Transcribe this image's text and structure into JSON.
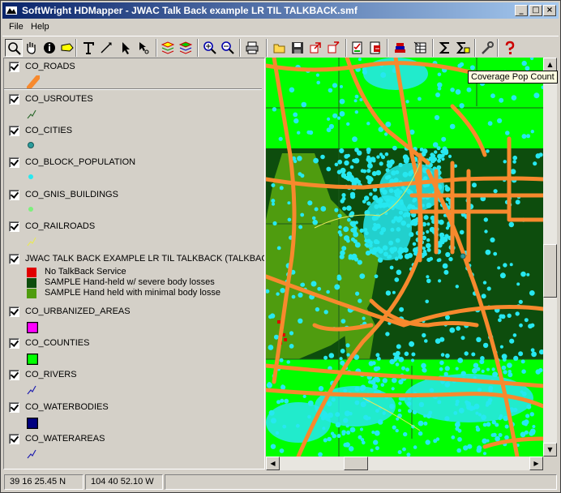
{
  "window": {
    "title": "SoftWright HDMapper - JWAC Talk Back example LR TIL TALKBACK.smf"
  },
  "window_controls": {
    "minimize": "_",
    "maximize": "□",
    "close": "×"
  },
  "menu": {
    "items": [
      "File",
      "Help"
    ]
  },
  "toolbar": {
    "tools": [
      "zoom-select-icon",
      "pan-hand-icon",
      "info-icon",
      "label-icon",
      "text-icon",
      "measure-line-icon",
      "select-arrow-icon",
      "node-select-icon",
      "layers-add-icon",
      "layers-edit-icon",
      "zoom-in-icon",
      "zoom-out-icon",
      "print-icon",
      "open-folder-icon",
      "save-icon",
      "export-icon",
      "import-icon",
      "checklist-icon",
      "report-icon",
      "stack-icon",
      "table-icon",
      "sum-icon",
      "sum-highlight-icon",
      "wrench-icon",
      "help-icon"
    ]
  },
  "tooltip": {
    "text": "Coverage Pop Count"
  },
  "legend": {
    "layers": [
      {
        "name": "CO_ROADS",
        "symbol": "road-line",
        "color": "#f7892d"
      },
      {
        "name": "CO_USROUTES",
        "symbol": "line",
        "color": "#2f6b2f"
      },
      {
        "name": "CO_CITIES",
        "symbol": "dot",
        "color": "#2a9c9c"
      },
      {
        "name": "CO_BLOCK_POPULATION",
        "symbol": "small-dot",
        "color": "#27e8f0"
      },
      {
        "name": "CO_GNIS_BUILDINGS",
        "symbol": "small-dot",
        "color": "#7df07d"
      },
      {
        "name": "CO_RAILROADS",
        "symbol": "line",
        "color": "#e8e85a"
      },
      {
        "name": "JWAC TALK BACK EXAMPLE LR TIL TALKBACK (TALKBACK)",
        "symbol": "classes",
        "classes": [
          {
            "label": "No TalkBack Service",
            "color": "#e00000"
          },
          {
            "label": "SAMPLE Hand-held w/ severe body losses",
            "color": "#0d4d0d"
          },
          {
            "label": "SAMPLE Hand held with minimal body losse",
            "color": "#4f9c0f"
          }
        ]
      },
      {
        "name": "CO_URBANIZED_AREAS",
        "symbol": "square",
        "color": "#ff00ff"
      },
      {
        "name": "CO_COUNTIES",
        "symbol": "square",
        "color": "#00ff00"
      },
      {
        "name": "CO_RIVERS",
        "symbol": "line",
        "color": "#2020b0"
      },
      {
        "name": "CO_WATERBODIES",
        "symbol": "square",
        "color": "#000080"
      },
      {
        "name": "CO_WATERAREAS",
        "symbol": "line",
        "color": "#2020b0"
      }
    ]
  },
  "status": {
    "latitude": "39 16 25.45 N",
    "longitude": "104 40 52.10 W"
  }
}
